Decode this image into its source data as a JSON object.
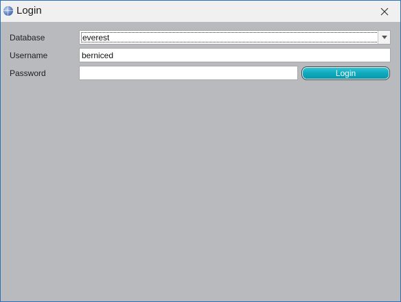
{
  "window": {
    "title": "Login"
  },
  "form": {
    "database_label": "Database",
    "database_value": "everest",
    "username_label": "Username",
    "username_value": "berniced",
    "password_label": "Password",
    "password_value": "",
    "login_button": "Login"
  },
  "icons": {
    "app": "globe-icon",
    "close": "close-icon",
    "dropdown": "chevron-down-icon"
  },
  "colors": {
    "background": "#b9babe",
    "button": "#0fa9bd",
    "titlebar": "#f0f0f0",
    "border": "#2d6fb4"
  }
}
